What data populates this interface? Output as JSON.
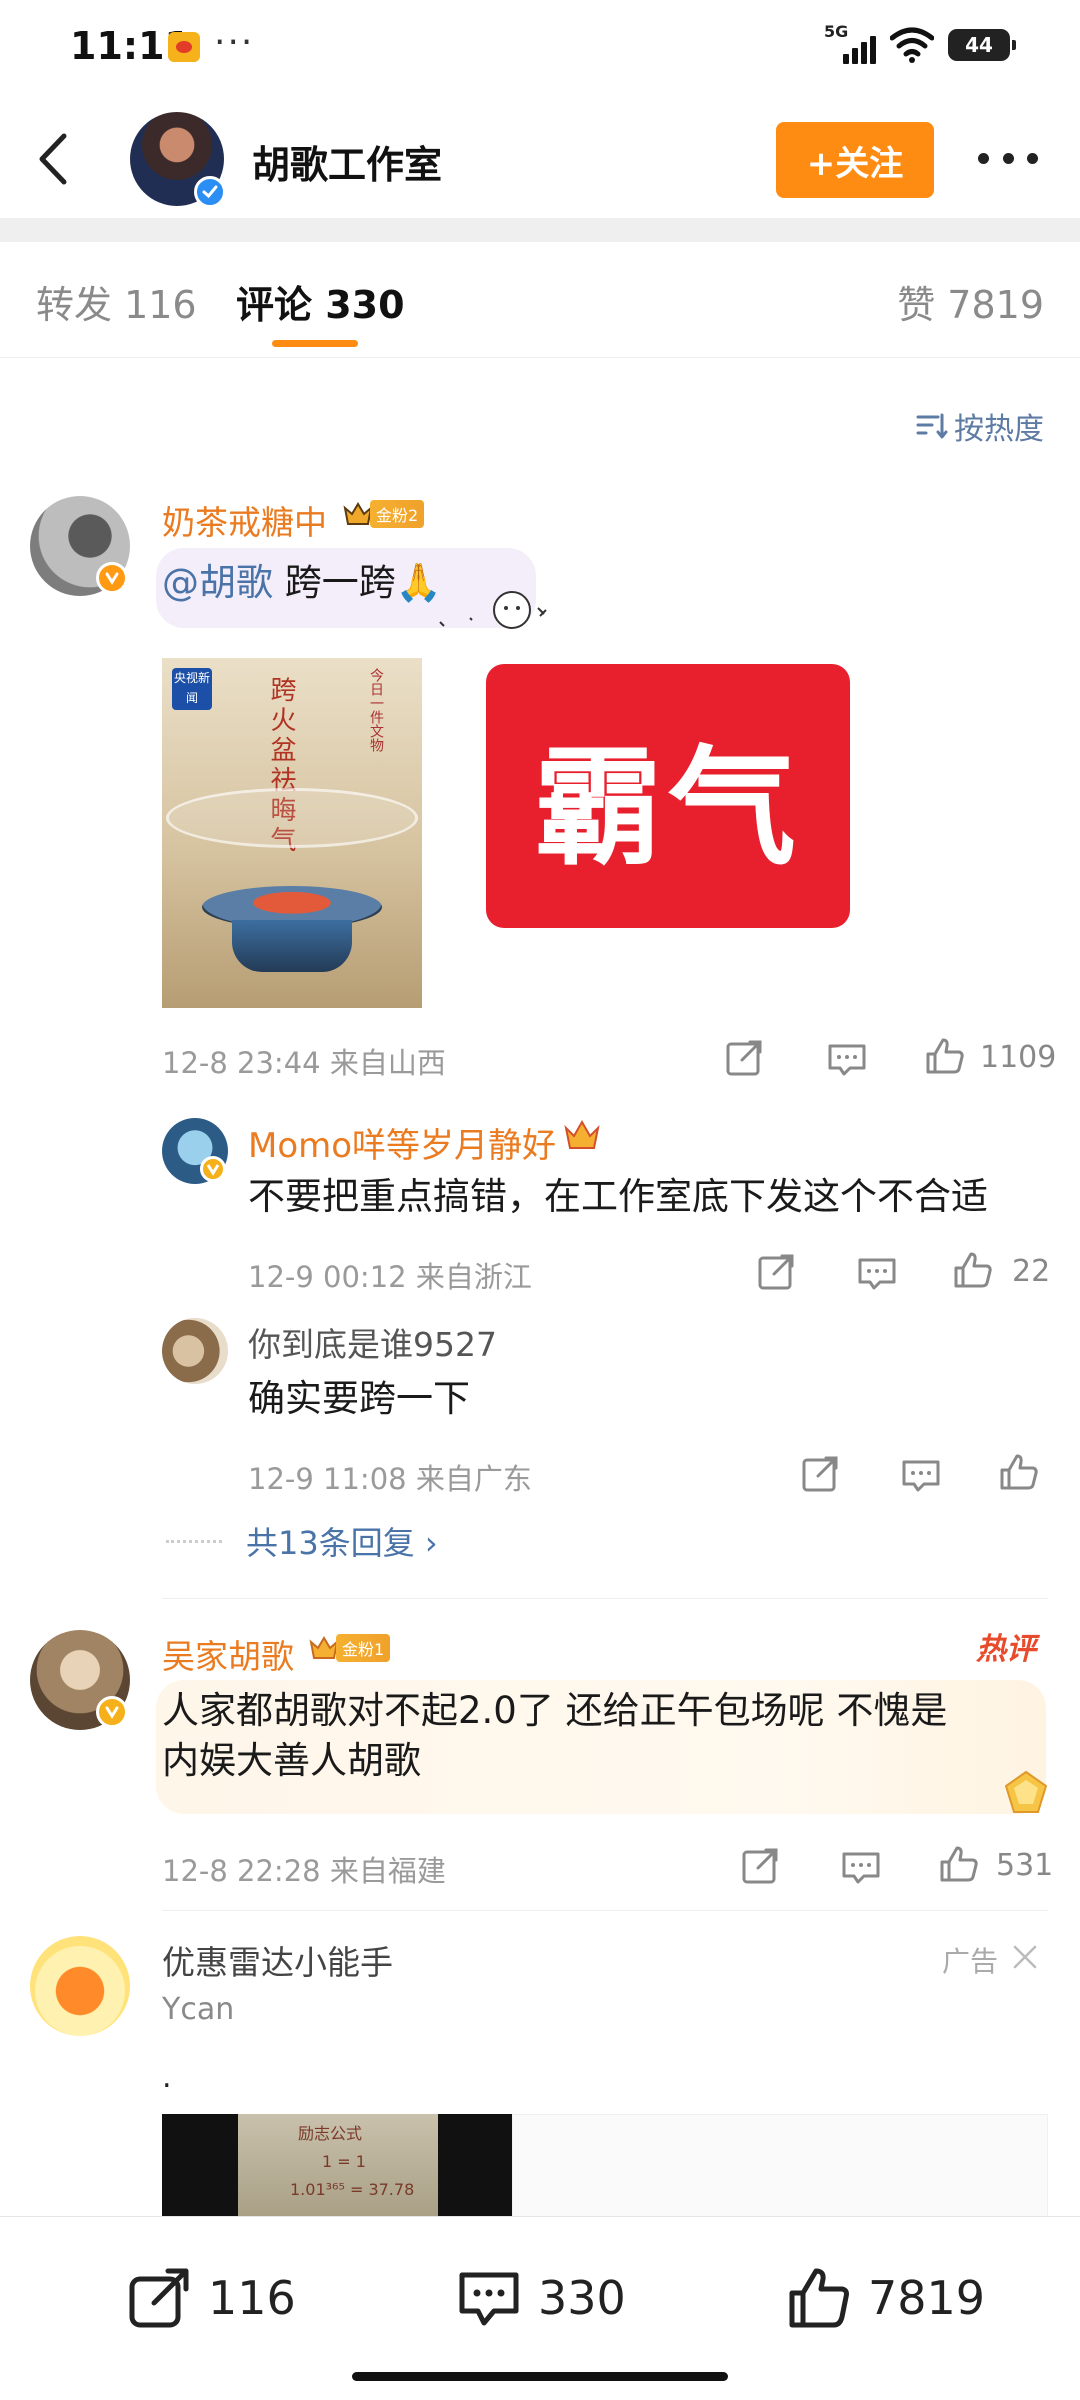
{
  "status": {
    "time": "11:11",
    "dots": "···",
    "network": "5G",
    "battery": "44"
  },
  "header": {
    "title": "胡歌工作室",
    "follow_label": "+关注"
  },
  "tabs": {
    "repost": "转发 116",
    "comment": "评论 330",
    "like": "赞 7819"
  },
  "sort": {
    "label": "按热度"
  },
  "comments": [
    {
      "username": "奶茶戒糖中",
      "fan_badge": "金粉2",
      "mention": "@胡歌",
      "text": " 跨一跨🙏",
      "image1_badge": "央视新闻",
      "image1_calligraphy": "跨火盆祛晦气",
      "image1_note": "今日一件文物",
      "image2_text": "霸气",
      "time_location": "12-8 23:44  来自山西",
      "likes": "1109",
      "replies": [
        {
          "username": "Momo咩等岁月静好",
          "text": "不要把重点搞错，在工作室底下发这个不合适",
          "time_location": "12-9 00:12  来自浙江",
          "likes": "22"
        },
        {
          "username": "你到底是谁9527",
          "text": "确实要跨一下",
          "time_location": "12-9 11:08  来自广东",
          "likes": ""
        }
      ],
      "more_replies": "共13条回复"
    },
    {
      "username": "吴家胡歌",
      "fan_badge": "金粉1",
      "hot_tag": "热评",
      "text_line1": "人家都胡歌对不起2.0了  还给正午包场呢 不愧是",
      "text_line2": "内娱大善人胡歌",
      "time_location": "12-8 22:28  来自福建",
      "likes": "531"
    }
  ],
  "ad": {
    "username": "优惠雷达小能手",
    "tag": "广告",
    "subtitle": "Ycan",
    "dot": ".",
    "image_text_1": "励志公式",
    "image_text_2": "1 = 1",
    "image_text_3": "1.01³⁶⁵ = 37.78"
  },
  "bottom_bar": {
    "repost": "116",
    "comment": "330",
    "like": "7819"
  },
  "colors": {
    "accent": "#ff8c12",
    "username": "#ea7b20",
    "link": "#4a73a8",
    "hot": "#e84b2c"
  }
}
